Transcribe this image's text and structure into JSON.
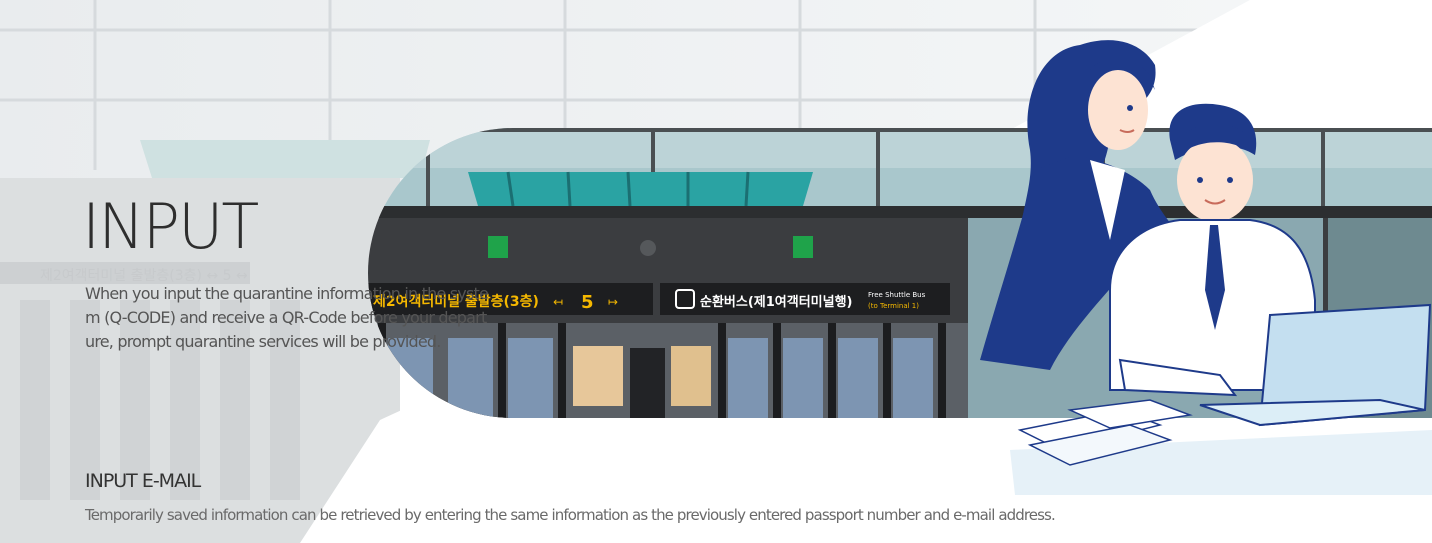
{
  "hero": {
    "title": "INPUT",
    "description": "When you input the quarantine information in the system (Q-CODE) and receive a QR-Code before your departure, prompt quarantine services will be provided."
  },
  "photo_signage": {
    "terminal_sign": "제2여객터미널 출발층(3층)",
    "gate_number": "5",
    "bus_sign": "순환버스(제1여객터미널행)",
    "shuttle_sign_line1": "Free Shuttle Bus",
    "shuttle_sign_line2": "(to Terminal 1)"
  },
  "email_section": {
    "title": "INPUT E-MAIL",
    "description": "Temporarily saved information can be retrieved by entering the same information as the previously entered passport number and e-mail address."
  },
  "colors": {
    "accent_navy": "#1e3a8a",
    "sky_teal": "#8fb8bf",
    "sign_yellow": "#f5b800",
    "exit_green": "#1fa34a"
  }
}
